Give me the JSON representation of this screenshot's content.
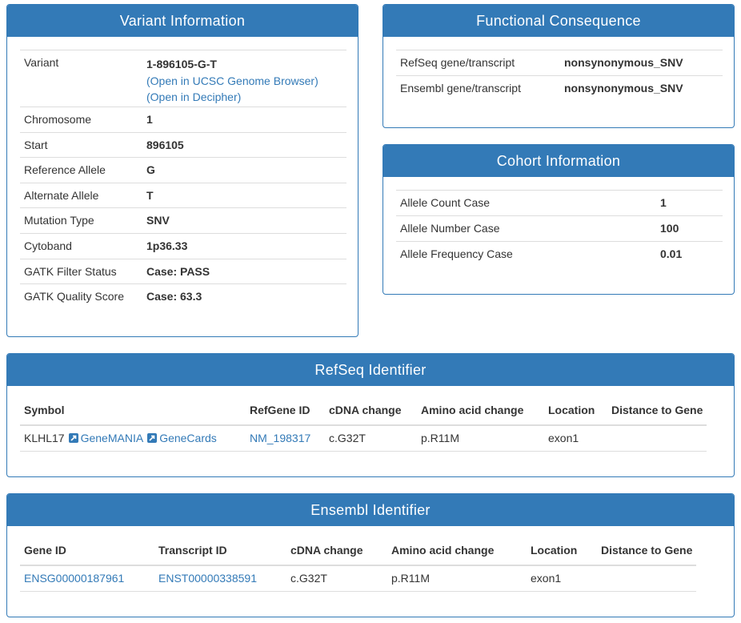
{
  "variant_panel": {
    "title": "Variant Information",
    "rows": [
      {
        "label": "Chromosome",
        "value": "1"
      },
      {
        "label": "Start",
        "value": "896105"
      },
      {
        "label": "Reference Allele",
        "value": "G"
      },
      {
        "label": "Alternate Allele",
        "value": "T"
      },
      {
        "label": "Mutation Type",
        "value": "SNV"
      },
      {
        "label": "Cytoband",
        "value": "1p36.33"
      },
      {
        "label": "GATK Filter Status",
        "value": "Case: PASS"
      },
      {
        "label": "GATK Quality Score",
        "value": "Case: 63.3"
      }
    ],
    "variant_label": "Variant",
    "variant_value": "1-896105-G-T",
    "ucsc_link": "(Open in UCSC Genome Browser)",
    "decipher_link": "(Open in Decipher)"
  },
  "functional_panel": {
    "title": "Functional Consequence",
    "rows": [
      {
        "label": "RefSeq gene/transcript",
        "value": "nonsynonymous_SNV"
      },
      {
        "label": "Ensembl gene/transcript",
        "value": "nonsynonymous_SNV"
      }
    ]
  },
  "cohort_panel": {
    "title": "Cohort Information",
    "rows": [
      {
        "label": "Allele Count Case",
        "value": "1"
      },
      {
        "label": "Allele Number Case",
        "value": "100"
      },
      {
        "label": "Allele Frequency Case",
        "value": "0.01"
      }
    ]
  },
  "refseq_panel": {
    "title": "RefSeq Identifier",
    "headers": [
      "Symbol",
      "RefGene ID",
      "cDNA change",
      "Amino acid change",
      "Location",
      "Distance to Gene"
    ],
    "row": {
      "symbol": "KLHL17",
      "genemania": "GeneMANIA",
      "genecards": "GeneCards",
      "refgene_id": "NM_198317",
      "cdna": "c.G32T",
      "amino": "p.R11M",
      "location": "exon1",
      "distance": ""
    },
    "external_icon": "external-link-icon"
  },
  "ensembl_panel": {
    "title": "Ensembl Identifier",
    "headers": [
      "Gene ID",
      "Transcript ID",
      "cDNA change",
      "Amino acid change",
      "Location",
      "Distance to Gene"
    ],
    "row": {
      "gene_id": "ENSG00000187961",
      "transcript_id": "ENST00000338591",
      "cdna": "c.G32T",
      "amino": "p.R11M",
      "location": "exon1",
      "distance": ""
    }
  },
  "colors": {
    "primary": "#337ab7",
    "border": "#dddddd",
    "text": "#333333"
  }
}
